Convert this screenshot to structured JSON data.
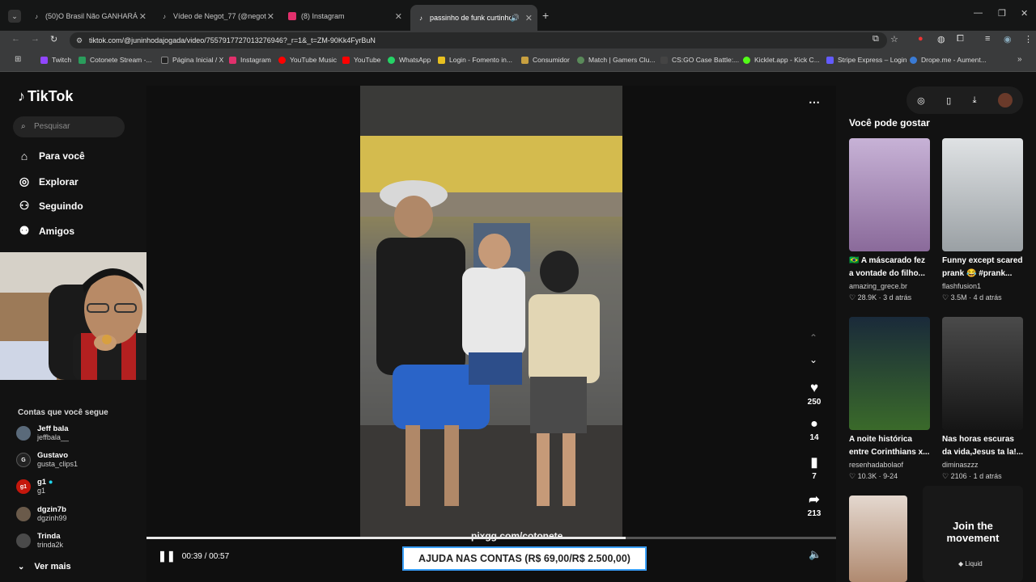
{
  "browser": {
    "tabs": [
      {
        "label": "(50)O Brasil Não GANHARÁ a C",
        "icon": "tiktok-icon"
      },
      {
        "label": "Vídeo de Negot_77 (@negot_7",
        "icon": "tiktok-icon"
      },
      {
        "label": "(8) Instagram",
        "icon": "instagram-icon"
      },
      {
        "label": "passinho de funk curtinho",
        "icon": "tiktok-icon"
      }
    ],
    "url": "tiktok.com/@juninhodajogada/video/7557917727013276946?_r=1&_t=ZM-90Kk4FyrBuN",
    "bookmarks": [
      {
        "label": "Twitch",
        "color": "#9146ff"
      },
      {
        "label": "Cotonete Stream -...",
        "color": "#2a9d5c"
      },
      {
        "label": "Página Inicial / X",
        "color": "#222222"
      },
      {
        "label": "Instagram",
        "color": "#e1306c"
      },
      {
        "label": "YouTube Music",
        "color": "#ff0000"
      },
      {
        "label": "YouTube",
        "color": "#ff0000"
      },
      {
        "label": "WhatsApp",
        "color": "#25d366"
      },
      {
        "label": "Login - Fomento in...",
        "color": "#e8c020"
      },
      {
        "label": "Consumidor",
        "color": "#c8a040"
      },
      {
        "label": "Match | Gamers Clu...",
        "color": "#5a8a5a"
      },
      {
        "label": "CS:GO Case Battle:...",
        "color": "#444444"
      },
      {
        "label": "Kicklet.app - Kick C...",
        "color": "#53fc18"
      },
      {
        "label": "Stripe Express – Login",
        "color": "#635bff"
      },
      {
        "label": "Drope.me - Aument...",
        "color": "#3a7bd5"
      }
    ]
  },
  "sidebar": {
    "logo": "TikTok",
    "search_placeholder": "Pesquisar",
    "nav": [
      {
        "label": "Para você",
        "icon": "home-icon"
      },
      {
        "label": "Explorar",
        "icon": "compass-icon"
      },
      {
        "label": "Seguindo",
        "icon": "following-icon"
      },
      {
        "label": "Amigos",
        "icon": "friends-icon"
      }
    ],
    "follow_header": "Contas que você segue",
    "follows": [
      {
        "name": "Jeff bala",
        "handle": "jeffbala__",
        "color": "#5a6a7a",
        "initial": ""
      },
      {
        "name": "Gustavo",
        "handle": "gusta_clips1",
        "color": "#222222",
        "initial": "G"
      },
      {
        "name": "g1",
        "handle": "g1",
        "color": "#c4170c",
        "initial": "g1"
      },
      {
        "name": "dgzin7b",
        "handle": "dgzinh99",
        "color": "#6a5a4a",
        "initial": ""
      },
      {
        "name": "Trinda",
        "handle": "trinda2k",
        "color": "#4a4a4a",
        "initial": ""
      }
    ],
    "see_more": "Ver mais"
  },
  "player": {
    "time": "00:39 / 00:57",
    "progress": 0.695,
    "watermark": "pixgg.com/cotonete",
    "banner": "AJUDA NAS CONTAS (R$ 69,00/R$ 2.500,00)",
    "likes": "250",
    "comments": "14",
    "saves": "7",
    "shares": "213"
  },
  "recommend": {
    "header": "Você pode gostar",
    "cards": [
      {
        "title": "🇧🇷 A máscarado fez a vontade do filho...",
        "user": "amazing_grece.br",
        "stat": "28.9K · 3 d atrás",
        "color": "#b9a3c9"
      },
      {
        "title": "Funny except scared prank 😂 #prank...",
        "user": "flashfusion1",
        "stat": "3.5M · 4 d atrás",
        "color": "#cfd3d6"
      },
      {
        "title": "A noite histórica entre Corinthians x...",
        "user": "resenhadabolaof",
        "stat": "10.3K · 9-24",
        "color": "#2b3f2a"
      },
      {
        "title": "Nas horas escuras da vida,Jesus ta la!...",
        "user": "diminaszzz",
        "stat": "2106 · 1 d atrás",
        "color": "#3a3a3a"
      }
    ],
    "join": "Join the movement",
    "join_brand": "Liquid"
  }
}
